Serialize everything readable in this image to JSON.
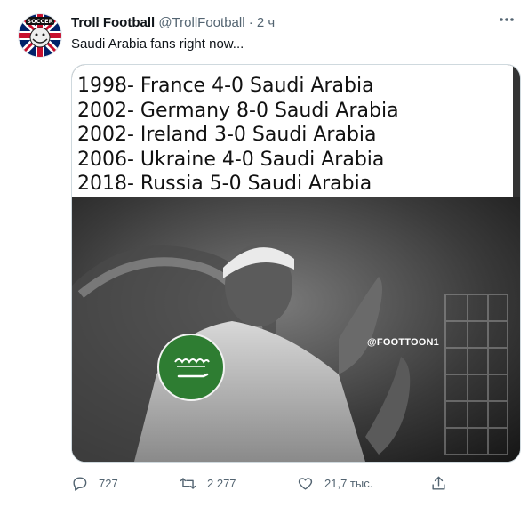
{
  "author": {
    "name": "Troll Football",
    "handle": "@TrollFootball",
    "separator": "·",
    "time": "2 ч",
    "avatar_text": "SOCCER"
  },
  "more_icon": "more-dots-icon",
  "tweet_text": "Saudi Arabia fans right now...",
  "media": {
    "caption_lines": [
      "1998- France 4-0 Saudi Arabia",
      "2002- Germany 8-0 Saudi Arabia",
      "2002- Ireland 3-0 Saudi Arabia",
      "2006- Ukraine 4-0 Saudi Arabia",
      "2018- Russia 5-0 Saudi Arabia"
    ],
    "watermark": "@FOOTTOON1"
  },
  "actions": {
    "reply": {
      "icon": "reply-icon",
      "count": "727"
    },
    "retweet": {
      "icon": "retweet-icon",
      "count": "2 277"
    },
    "like": {
      "icon": "heart-icon",
      "count": "21,7 тыс."
    },
    "share": {
      "icon": "share-icon"
    }
  },
  "colors": {
    "text": "#0f1419",
    "secondary": "#536471",
    "border": "#cfd9de",
    "flag_green": "#2e7d32"
  }
}
